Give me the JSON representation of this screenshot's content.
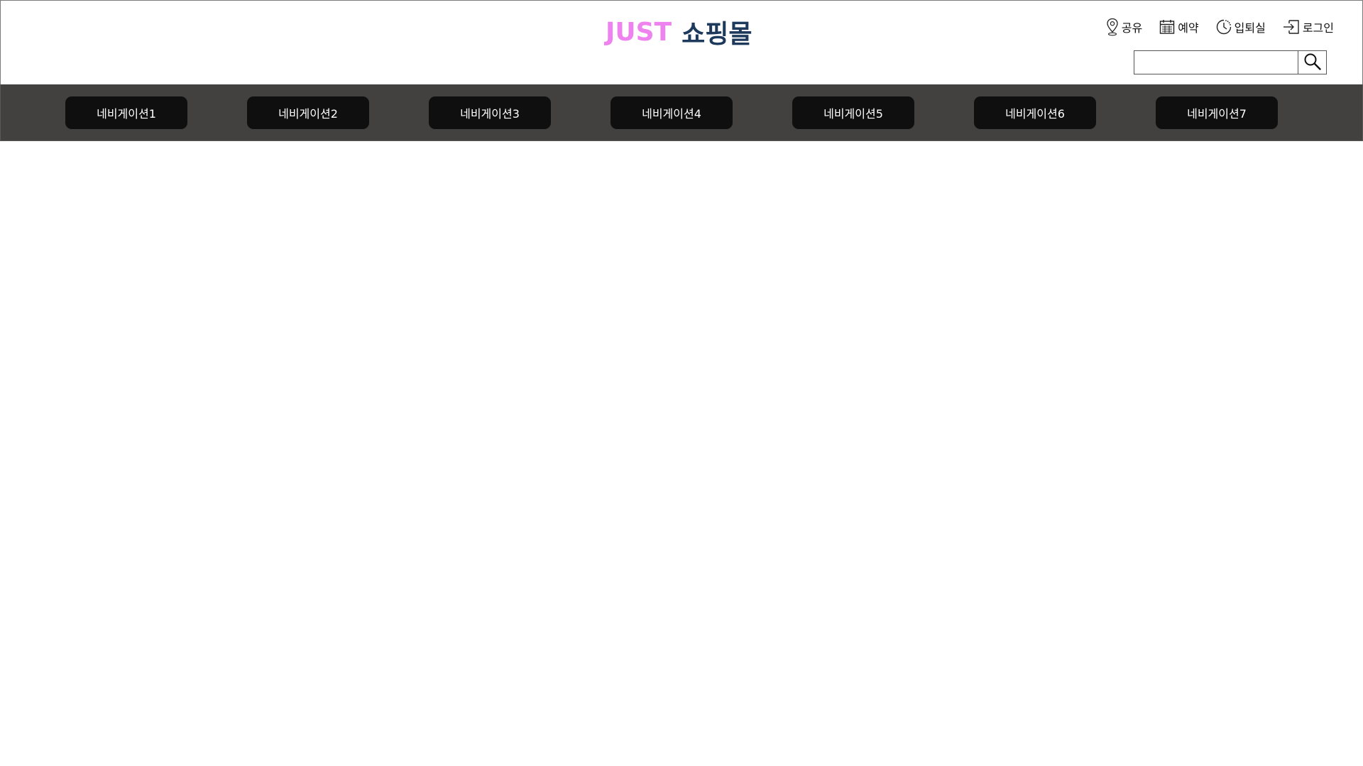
{
  "header": {
    "logo": {
      "part1": "JUST",
      "part2": "쇼핑몰",
      "part1_color": "#ee82ee",
      "part2_color": "#1d3a5c"
    },
    "utility": [
      {
        "label": "공유",
        "icon": "location-pin-icon"
      },
      {
        "label": "예약",
        "icon": "calendar-icon"
      },
      {
        "label": "입퇴실",
        "icon": "clock-icon"
      },
      {
        "label": "로그인",
        "icon": "login-icon"
      }
    ],
    "search": {
      "value": "",
      "placeholder": "",
      "button_icon": "search-icon"
    }
  },
  "nav": {
    "background": "#434040",
    "button_color": "#0f0f0f",
    "items": [
      {
        "label": "네비게이션1"
      },
      {
        "label": "네비게이션2"
      },
      {
        "label": "네비게이션3"
      },
      {
        "label": "네비게이션4"
      },
      {
        "label": "네비게이션5"
      },
      {
        "label": "네비게이션6"
      },
      {
        "label": "네비게이션7"
      }
    ]
  }
}
